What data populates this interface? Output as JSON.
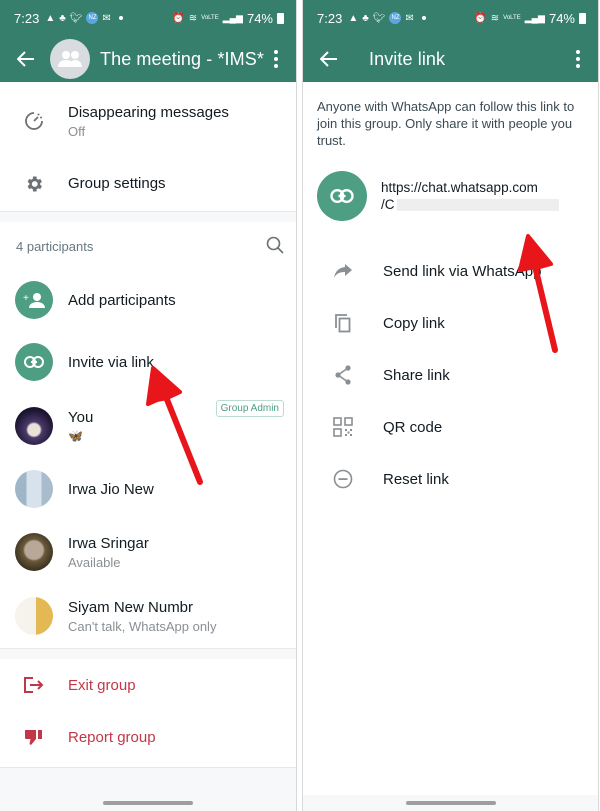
{
  "status_bar": {
    "time": "7:23",
    "notification_icons": [
      "photos-icon",
      "wellbeing-icon",
      "twitter-icon",
      "nz-badge-icon",
      "mail-icon",
      "dot-icon"
    ],
    "nz_badge": "NZ",
    "right_icons": [
      "alarm-icon",
      "wifi-icon",
      "volte-icon",
      "signal-icon"
    ],
    "volte_label": "VoLTE",
    "battery": "74%"
  },
  "left": {
    "title": "The meeting - *IMS*",
    "settings": [
      {
        "label": "Disappearing messages",
        "sub": "Off",
        "icon": "timer-icon"
      },
      {
        "label": "Group settings",
        "icon": "gear-icon"
      }
    ],
    "participants_header": "4 participants",
    "actions": [
      {
        "label": "Add participants",
        "icon": "add-person-icon"
      },
      {
        "label": "Invite via link",
        "icon": "link-icon"
      }
    ],
    "participants": [
      {
        "name": "You",
        "status": "🦋",
        "badge": "Group Admin"
      },
      {
        "name": "Irwa Jio New",
        "status": ""
      },
      {
        "name": "Irwa Sringar",
        "status": "Available"
      },
      {
        "name": "Siyam New Numbr",
        "status": "Can't talk, WhatsApp only"
      }
    ],
    "danger_actions": [
      {
        "label": "Exit group",
        "icon": "exit-icon"
      },
      {
        "label": "Report group",
        "icon": "thumbs-down-icon"
      }
    ]
  },
  "right": {
    "title": "Invite link",
    "description": "Anyone with WhatsApp can follow this link to join this group. Only share it with people you trust.",
    "link_line1": "https://chat.whatsapp.com",
    "link_line2": "/C",
    "actions": [
      {
        "label": "Send link via WhatsApp",
        "icon": "forward-icon"
      },
      {
        "label": "Copy link",
        "icon": "copy-icon"
      },
      {
        "label": "Share link",
        "icon": "share-icon"
      },
      {
        "label": "QR code",
        "icon": "qr-code-icon"
      },
      {
        "label": "Reset link",
        "icon": "reset-icon"
      }
    ]
  },
  "colors": {
    "header_green": "#357f6c",
    "accent_green": "#4e9e84",
    "danger_red": "#c13747",
    "annotation_red": "#e8161b"
  }
}
